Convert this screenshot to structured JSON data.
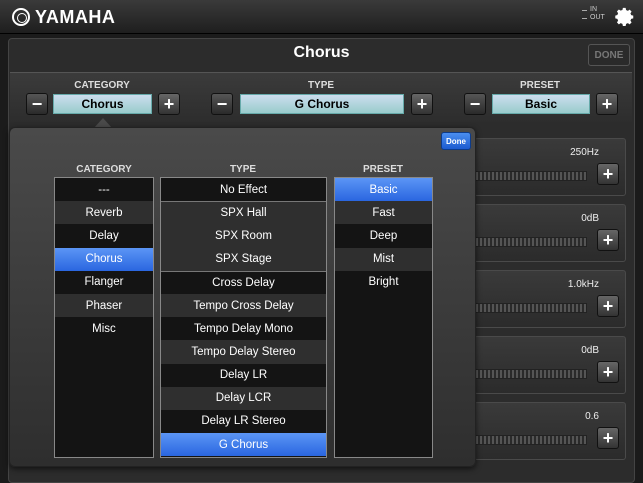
{
  "brand": {
    "logo_text": "YAMAHA",
    "logo_icon": "yamaha-tuning-fork-logo"
  },
  "io": {
    "in_label": "IN",
    "out_label": "OUT"
  },
  "icons": {
    "settings": "gear-icon"
  },
  "page": {
    "title": "Chorus",
    "done_label": "DONE"
  },
  "selectors": {
    "category": {
      "label": "CATEGORY",
      "value": "Chorus"
    },
    "type": {
      "label": "TYPE",
      "value": "G Chorus"
    },
    "preset": {
      "label": "PRESET",
      "value": "Basic"
    },
    "minus_symbol": "−",
    "plus_symbol": "+"
  },
  "params": [
    {
      "value": "250Hz"
    },
    {
      "value": "0dB"
    },
    {
      "value": "1.0kHz"
    },
    {
      "value": "0dB"
    },
    {
      "value": "0.6"
    }
  ],
  "popover": {
    "done_label": "Done",
    "headers": {
      "category": "CATEGORY",
      "type": "TYPE",
      "preset": "PRESET"
    },
    "categories": [
      "---",
      "Reverb",
      "Delay",
      "Chorus",
      "Flanger",
      "Phaser",
      "Misc"
    ],
    "selected_category": "Chorus",
    "types": [
      "No Effect",
      "SPX Hall",
      "SPX Room",
      "SPX Stage",
      "Cross Delay",
      "Tempo Cross Delay",
      "Tempo Delay Mono",
      "Tempo Delay Stereo",
      "Delay LR",
      "Delay LCR",
      "Delay LR Stereo",
      "G Chorus"
    ],
    "selected_type": "G Chorus",
    "presets": [
      "Basic",
      "Fast",
      "Deep",
      "Mist",
      "Bright"
    ],
    "selected_preset": "Basic"
  },
  "colors": {
    "accent": "#2a66e0",
    "field": "#a8d0d0"
  }
}
